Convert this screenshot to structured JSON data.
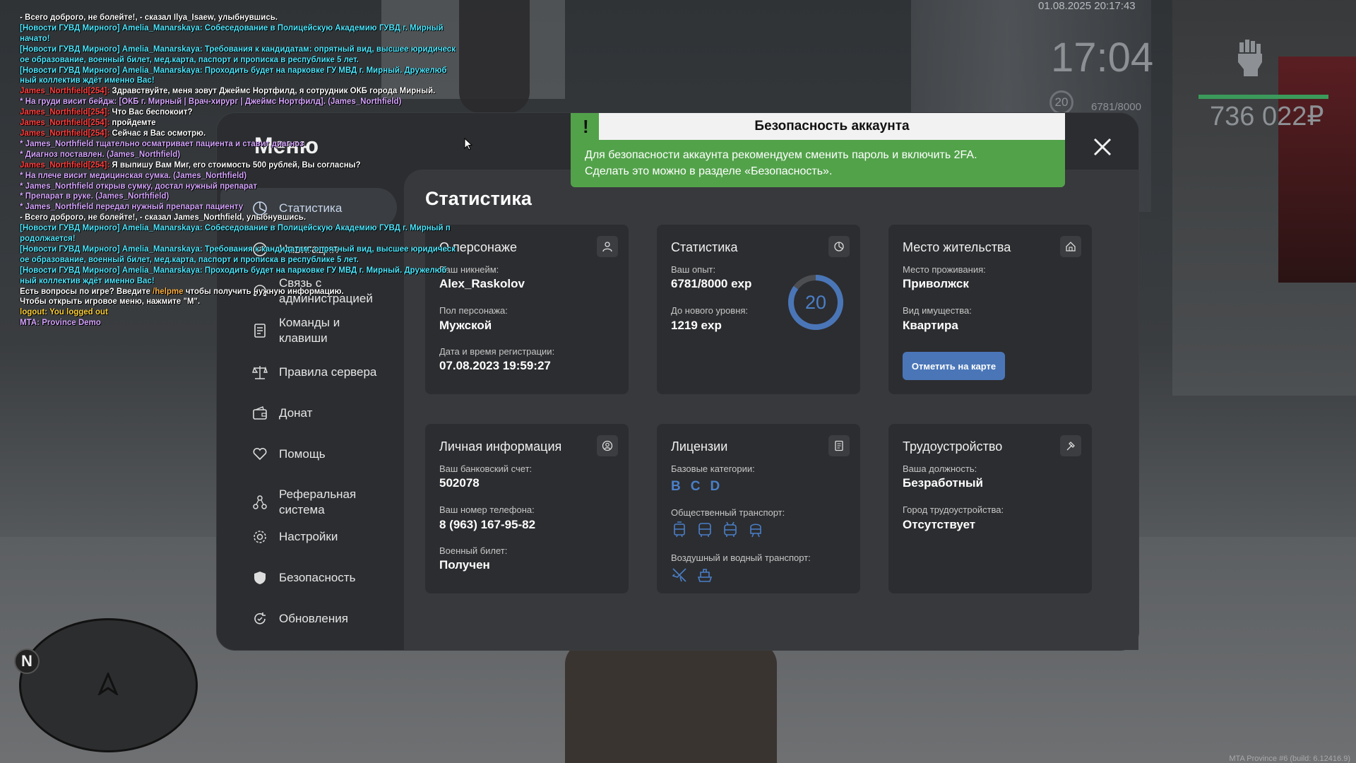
{
  "hud": {
    "datetime": "01.08.2025 20:17:43",
    "time": "17:04",
    "level": "20",
    "exp": "6781/8000",
    "money": "736 022₽",
    "build": "MTA Province #6 (build: 6.12416.9)"
  },
  "chat": [
    {
      "text": "- Всего доброго, не болейте!, - сказал Ilya_Isaew, улыбнувшись.",
      "color": "#ffffff"
    },
    {
      "text": "[Новости ГУВД Мирного] Amelia_Manarskaya: Собеседование в Полицейскую Академию ГУВД г. Мирный",
      "color": "#4ee8ff"
    },
    {
      "text": "начато!",
      "color": "#4ee8ff"
    },
    {
      "text": "[Новости ГУВД Мирного] Amelia_Manarskaya: Требования к кандидатам: опрятный вид, высшее юридическ",
      "color": "#4ee8ff"
    },
    {
      "text": "ое образование, военный билет, мед.карта, паспорт и прописка в республике 5 лет.",
      "color": "#4ee8ff"
    },
    {
      "text": "[Новости ГУВД Мирного] Amelia_Manarskaya: Проходить будет на парковке ГУ МВД г. Мирный. Дружелюб",
      "color": "#4ee8ff"
    },
    {
      "text": "ный коллектив ждёт именно Вас!",
      "color": "#4ee8ff"
    },
    {
      "text": "James_Northfield[254]: Здравствуйте, меня зовут Джеймс Нортфилд, я сотрудник ОКБ города Мирный.",
      "color": "#ffffff",
      "name": "James_Northfield[254]:"
    },
    {
      "text": "* На груди висит бейдж: [ОКБ г. Мирный | Врач-хирург | Джеймс Нортфилд]. (James_Northfield)",
      "color": "#d6a6ff"
    },
    {
      "text": "James_Northfield[254]: Что Вас беспокоит?",
      "color": "#ffffff",
      "name": "James_Northfield[254]:"
    },
    {
      "text": "James_Northfield[254]: пройдемте",
      "color": "#ffffff",
      "name": "James_Northfield[254]:"
    },
    {
      "text": "James_Northfield[254]: Сейчас я Вас осмотрю.",
      "color": "#ffffff",
      "name": "James_Northfield[254]:"
    },
    {
      "text": "* James_Northfield тщательно осматривает пациента и ставит диагноз",
      "color": "#d6a6ff"
    },
    {
      "text": "* Диагноз поставлен. (James_Northfield)",
      "color": "#d6a6ff"
    },
    {
      "text": "James_Northfield[254]: Я выпишу Вам Миг, его стоимость 500 рублей, Вы согласны?",
      "color": "#ffffff",
      "name": "James_Northfield[254]:"
    },
    {
      "text": "* На плече висит медицинская сумка. (James_Northfield)",
      "color": "#d6a6ff"
    },
    {
      "text": "* James_Northfield открыв сумку, достал нужный препарат",
      "color": "#d6a6ff"
    },
    {
      "text": "* Препарат в руке. (James_Northfield)",
      "color": "#d6a6ff"
    },
    {
      "text": "* James_Northfield передал нужный препарат пациенту",
      "color": "#d6a6ff"
    },
    {
      "text": "- Всего доброго, не болейте!, - сказал James_Northfield, улыбнувшись.",
      "color": "#ffffff"
    },
    {
      "text": "[Новости ГУВД Мирного] Amelia_Manarskaya: Собеседование в Полицейскую Академию ГУВД г. Мирный п",
      "color": "#4ee8ff"
    },
    {
      "text": "родолжается!",
      "color": "#4ee8ff"
    },
    {
      "text": "[Новости ГУВД Мирного] Amelia_Manarskaya: Требования к кандидатам: опрятный вид, высшее юридическ",
      "color": "#4ee8ff"
    },
    {
      "text": "ое образование, военный билет, мед.карта, паспорт и прописка в республике 5 лет.",
      "color": "#4ee8ff"
    },
    {
      "text": "[Новости ГУВД Мирного] Amelia_Manarskaya: Проходить будет на парковке ГУ МВД г. Мирный. Дружелюб",
      "color": "#4ee8ff"
    },
    {
      "text": "ный коллектив ждёт именно Вас!",
      "color": "#4ee8ff"
    },
    {
      "text": "Есть вопросы по игре? Введите /helpme чтобы получить нужную информацию.",
      "color": "#ffffff",
      "hl": "/helpme"
    },
    {
      "text": "Чтобы открыть игровое меню, нажмите \"M\".",
      "color": "#ffffff"
    },
    {
      "text": "logout: You logged out",
      "color": "#ffd23a"
    },
    {
      "text": "MTA: Province Demo",
      "color": "#d6a6ff"
    }
  ],
  "menu": {
    "title": "Меню",
    "page_title": "Статистика",
    "sidebar": [
      {
        "label": "Статистика",
        "icon": "pie-chart-icon"
      },
      {
        "label": "Навигация",
        "icon": "compass-icon"
      },
      {
        "label": "Связь с администрацией",
        "icon": "headset-icon"
      },
      {
        "label": "Команды и клавиши",
        "icon": "document-icon"
      },
      {
        "label": "Правила сервера",
        "icon": "scales-icon"
      },
      {
        "label": "Донат",
        "icon": "wallet-icon"
      },
      {
        "label": "Помощь",
        "icon": "heart-hand-icon"
      },
      {
        "label": "Реферальная система",
        "icon": "referral-icon"
      },
      {
        "label": "Настройки",
        "icon": "gear-icon"
      },
      {
        "label": "Безопасность",
        "icon": "shield-icon"
      },
      {
        "label": "Обновления",
        "icon": "refresh-icon"
      }
    ]
  },
  "cards": {
    "character": {
      "title": "О персонаже",
      "nick_label": "Ваш никнейм:",
      "nick": "Alex_Raskolov",
      "gender_label": "Пол персонажа:",
      "gender": "Мужской",
      "reg_label": "Дата и время регистрации:",
      "reg": "07.08.2023 19:59:27"
    },
    "stats": {
      "title": "Статистика",
      "exp_label": "Ваш опыт:",
      "exp": "6781/8000 exp",
      "next_label": "До нового уровня:",
      "next": "1219 exp",
      "level": "20",
      "level_progress": 0.85
    },
    "residence": {
      "title": "Место жительства",
      "place_label": "Место проживания:",
      "place": "Приволжск",
      "type_label": "Вид имущества:",
      "type": "Квартира",
      "button": "Отметить на карте"
    },
    "personal": {
      "title": "Личная информация",
      "bank_label": "Ваш банковский счет:",
      "bank": "502078",
      "phone_label": "Ваш номер телефона:",
      "phone": "8 (963) 167-95-82",
      "military_label": "Военный билет:",
      "military": "Получен"
    },
    "licenses": {
      "title": "Лицензии",
      "base_label": "Базовые категории:",
      "base": [
        "B",
        "C",
        "D"
      ],
      "public_label": "Общественный транспорт:",
      "air_label": "Воздушный и водный транспорт:"
    },
    "job": {
      "title": "Трудоустройство",
      "pos_label": "Ваша должность:",
      "pos": "Безработный",
      "city_label": "Город трудоустройства:",
      "city": "Отсутствует"
    }
  },
  "notification": {
    "mark": "!",
    "title": "Безопасность аккаунта",
    "line1": "Для безопасности аккаунта рекомендуем сменить пароль и включить 2FA.",
    "line2": "Сделать это можно в разделе «Безопасность»."
  },
  "colors": {
    "accent": "#4a76b8",
    "notif_green": "#52a24a",
    "license_blue": "#4a7fc8"
  }
}
